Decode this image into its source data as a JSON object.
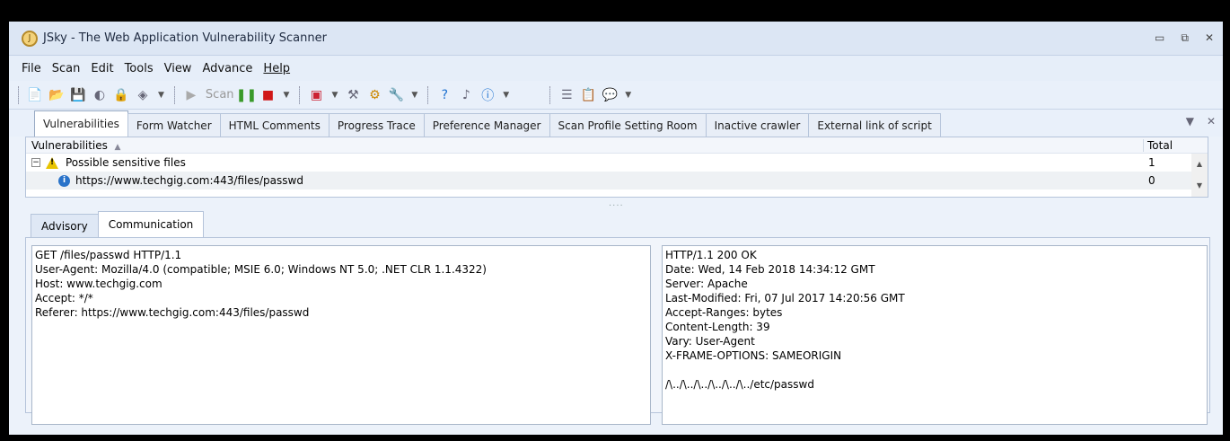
{
  "window": {
    "title": "JSky - The Web Application Vulnerability Scanner",
    "controls": {
      "minimize": "▭",
      "restore": "⧉",
      "close": "✕"
    }
  },
  "menu": [
    "File",
    "Scan",
    "Edit",
    "Tools",
    "View",
    "Advance",
    "Help"
  ],
  "toolbar": {
    "scan_label": "Scan"
  },
  "tabs": [
    "Vulnerabilities",
    "Form Watcher",
    "HTML Comments",
    "Progress Trace",
    "Preference Manager",
    "Scan Profile Setting Room",
    "Inactive crawler",
    "External link of script"
  ],
  "vulnerabilities": {
    "header": "Vulnerabilities",
    "sort_glyph": "▲",
    "total_header": "Total",
    "group": {
      "expander": "−",
      "label": "Possible sensitive files",
      "total": "1"
    },
    "item": {
      "label": "https://www.techgig.com:443/files/passwd",
      "total": "0"
    }
  },
  "subtabs": [
    "Advisory",
    "Communication"
  ],
  "request": "GET /files/passwd HTTP/1.1\nUser-Agent: Mozilla/4.0 (compatible; MSIE 6.0; Windows NT 5.0; .NET CLR 1.1.4322)\nHost: www.techgig.com\nAccept: */*\nReferer: https://www.techgig.com:443/files/passwd",
  "response": "HTTP/1.1 200 OK\nDate: Wed, 14 Feb 2018 14:34:12 GMT\nServer: Apache\nLast-Modified: Fri, 07 Jul 2017 14:20:56 GMT\nAccept-Ranges: bytes\nContent-Length: 39\nVary: User-Agent\nX-FRAME-OPTIONS: SAMEORIGIN\n\n/\\../\\../\\../\\../\\../\\../etc/passwd",
  "icons": [
    "app-logo-icon",
    "new-scan-icon",
    "open-icon",
    "save-icon",
    "globe-icon",
    "lock-icon",
    "export-icon",
    "play-icon",
    "pause-icon",
    "stop-icon",
    "profile-icon",
    "tools-icon",
    "settings-icon",
    "wrench-icon",
    "help-icon",
    "update-icon",
    "info-icon",
    "list-icon",
    "report-icon",
    "chat-icon",
    "warning-icon"
  ]
}
